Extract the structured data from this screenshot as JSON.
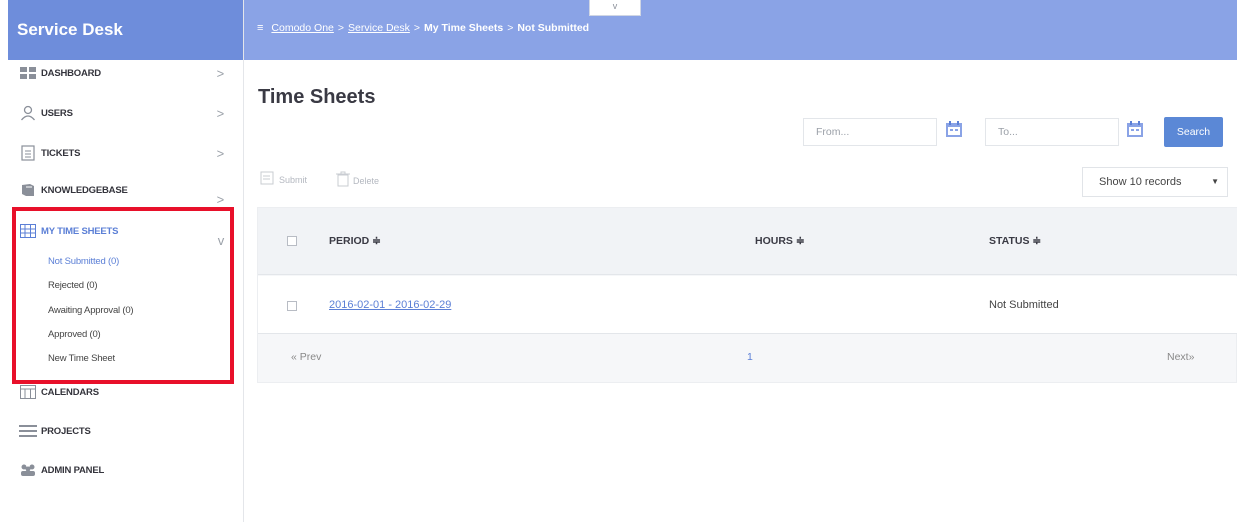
{
  "sidebar": {
    "brand": "Service Desk",
    "items": [
      {
        "label": "DASHBOARD",
        "icon": "grid-icon",
        "chevron": ">"
      },
      {
        "label": "USERS",
        "icon": "user-icon",
        "chevron": ">"
      },
      {
        "label": "TICKETS",
        "icon": "document-icon",
        "chevron": ">"
      },
      {
        "label": "KNOWLEDGEBASE",
        "icon": "book-icon",
        "chevron": ">"
      },
      {
        "label": "MY TIME SHEETS",
        "icon": "table-icon",
        "chevron": "v"
      },
      {
        "label": "CALENDARS",
        "icon": "calendar-icon"
      },
      {
        "label": "PROJECTS",
        "icon": "list-icon"
      },
      {
        "label": "ADMIN PANEL",
        "icon": "users-icon"
      }
    ],
    "time_sheet_sub": [
      "Not Submitted (0)",
      "Rejected (0)",
      "Awaiting Approval (0)",
      "Approved (0)",
      "New Time Sheet"
    ]
  },
  "topbar": {
    "menu_icon": "≡",
    "crumbs": [
      "Comodo One",
      "Service Desk",
      "My Time Sheets",
      "Not Submitted"
    ],
    "sep": ">",
    "collapse_glyph": "v"
  },
  "main": {
    "title": "Time Sheets",
    "from_placeholder": "From...",
    "to_placeholder": "To...",
    "search_label": "Search",
    "submit_label": "Submit",
    "delete_label": "Delete",
    "records_label": "Show 10 records",
    "records_caret": "▼",
    "columns": [
      "PERIOD ≑",
      "HOURS ≑",
      "STATUS ≑"
    ],
    "rows": [
      {
        "period": "2016-02-01 - 2016-02-29",
        "hours": "",
        "status": "Not Submitted"
      }
    ],
    "pager": {
      "prev": "« Prev",
      "page": "1",
      "next": "Next»"
    }
  },
  "colors": {
    "brand": "#6e8ddb",
    "topbar": "#8aa3e6",
    "accent": "#5b7fd6",
    "highlight": "#e8102a"
  }
}
